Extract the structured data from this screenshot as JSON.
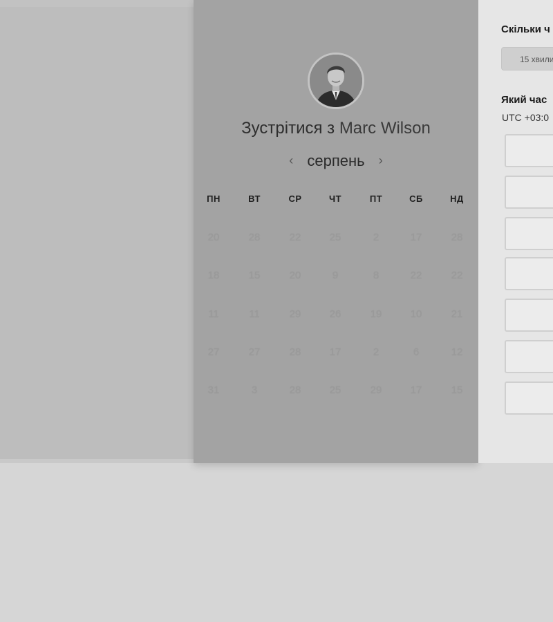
{
  "calendar": {
    "title_prefix": "Зустрітися з",
    "host_name": "Marc Wilson",
    "month": "серпень",
    "prev_icon": "‹",
    "next_icon": "›",
    "weekdays": [
      "ПН",
      "ВТ",
      "СР",
      "ЧТ",
      "ПТ",
      "СБ",
      "НД"
    ],
    "weeks": [
      [
        "20",
        "28",
        "22",
        "25",
        "2",
        "17",
        "28"
      ],
      [
        "18",
        "15",
        "20",
        "9",
        "8",
        "22",
        "22"
      ],
      [
        "11",
        "11",
        "29",
        "26",
        "19",
        "10",
        "21"
      ],
      [
        "27",
        "27",
        "28",
        "17",
        "2",
        "6",
        "12"
      ],
      [
        "31",
        "3",
        "28",
        "25",
        "29",
        "17",
        "15"
      ]
    ]
  },
  "booking": {
    "duration_question": "Скільки ч",
    "duration_value": "15 хвили",
    "time_question": "Який час",
    "timezone": "UTC +03:0",
    "slot_count": 7
  }
}
